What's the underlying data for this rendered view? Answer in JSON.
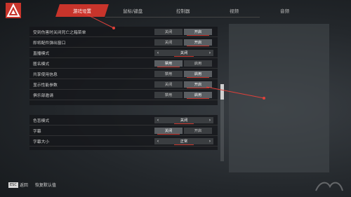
{
  "tabs": [
    "游戏设置",
    "鼠标/键盘",
    "控制器",
    "视频",
    "音频"
  ],
  "active_tab_index": 0,
  "settings_group1": [
    {
      "label": "受到伤害时关闭死亡之箱菜单",
      "type": "toggle",
      "options": [
        "关闭",
        "开启"
      ],
      "selected": 1
    },
    {
      "label": "即将配件弹出窗口",
      "type": "toggle",
      "options": [
        "关闭",
        "开启"
      ],
      "selected": 1
    },
    {
      "label": "直播模式",
      "type": "select",
      "value": "关闭"
    },
    {
      "label": "匿名模式",
      "type": "toggle",
      "options": [
        "禁用",
        "启用"
      ],
      "selected": 0
    },
    {
      "label": "共享使用信息",
      "type": "toggle",
      "options": [
        "禁用",
        "启用"
      ],
      "selected": 1
    },
    {
      "label": "显示性能参数",
      "type": "toggle",
      "options": [
        "关闭",
        "开启"
      ],
      "selected": 1
    },
    {
      "label": "俱乐部邀请",
      "type": "toggle",
      "options": [
        "禁用",
        "启用"
      ],
      "selected": 1
    }
  ],
  "settings_group2": [
    {
      "label": "色盲模式",
      "type": "select",
      "value": "关闭"
    },
    {
      "label": "字幕",
      "type": "toggle",
      "options": [
        "关闭",
        "开启"
      ],
      "selected": 0
    },
    {
      "label": "字幕大小",
      "type": "select",
      "value": "正常"
    }
  ],
  "footer": {
    "esc_key": "ESC",
    "back_label": "返回",
    "reset_label": "恢复默认值"
  },
  "colors": {
    "accent": "#c8342b",
    "panel": "#141619"
  }
}
